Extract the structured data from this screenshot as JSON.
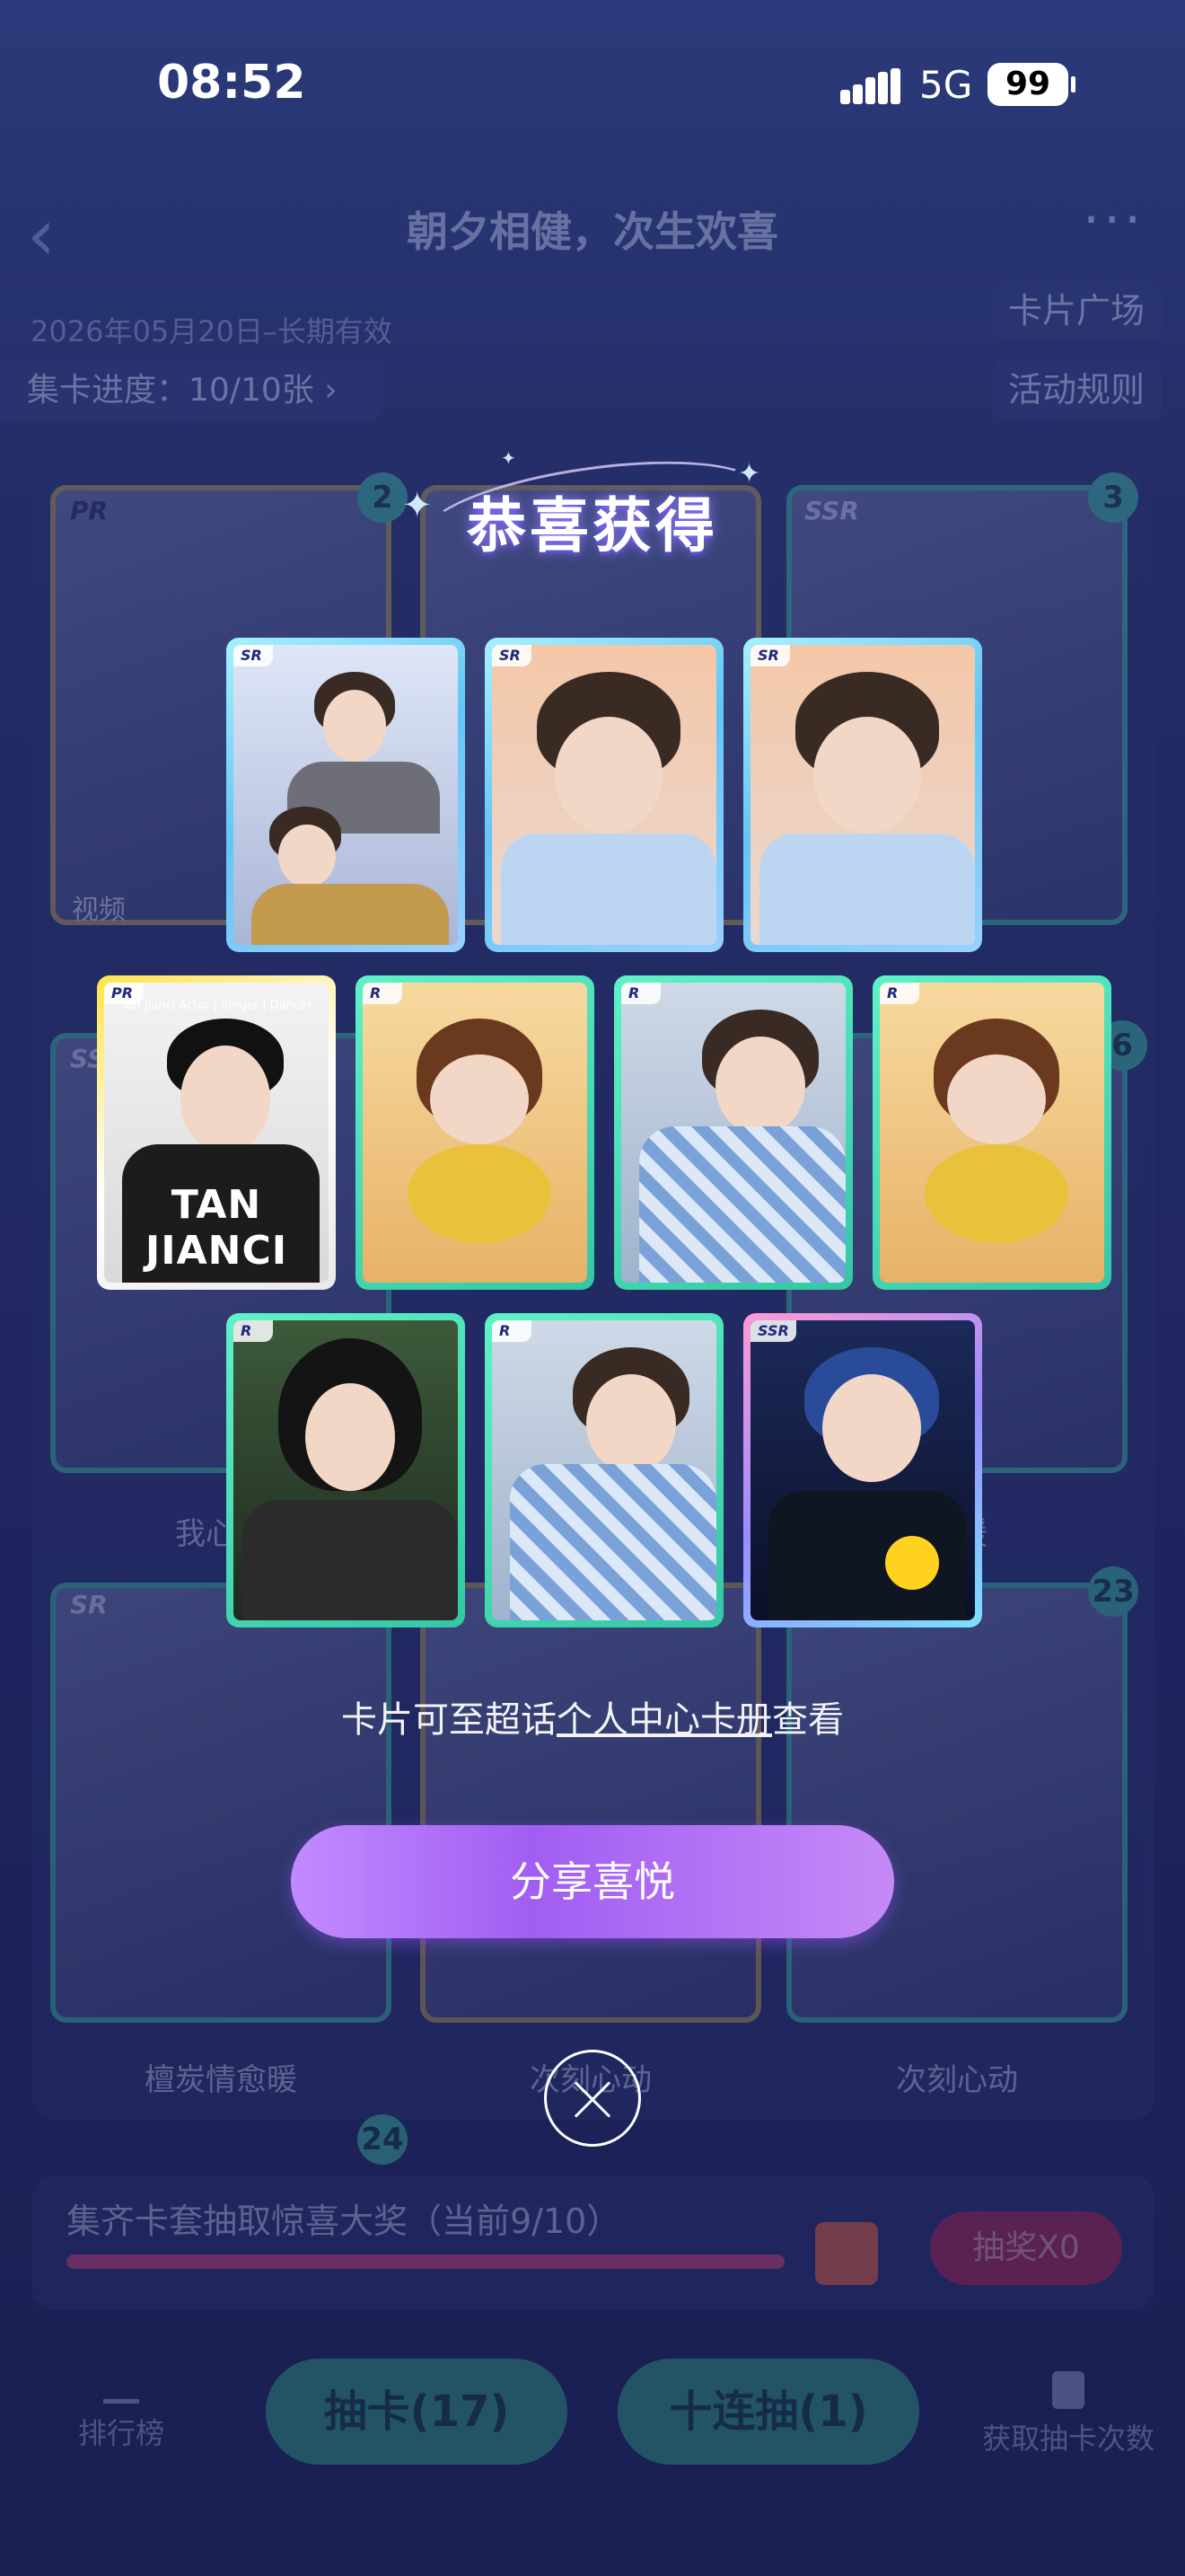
{
  "status": {
    "time": "08:52",
    "network": "5G",
    "battery": "99"
  },
  "page": {
    "title": "朝夕相健，次生欢喜",
    "validity": "2026年05月20日–长期有效",
    "progress": "集卡进度：10/10张 ›",
    "card_square": "卡片广场",
    "rules": "活动规则",
    "video_tag": "视频",
    "bg_labels": [
      "我心安",
      "愈暖",
      "檀炭情愈暖",
      "次刻心动",
      "次刻心动"
    ],
    "bg_counts": [
      "2",
      "3",
      "6",
      "23",
      "24"
    ],
    "bg_rarity": [
      "PR",
      "SSR",
      "SS",
      "SR"
    ],
    "collect_text": "集齐卡套抽取惊喜大奖（当前9/10）",
    "lottery_btn": "抽奖X0",
    "tabs": {
      "rank": "排行榜",
      "get_draws": "获取抽卡次数"
    },
    "draw_btn": "抽卡(17)",
    "ten_draw_btn": "十连抽(1)"
  },
  "modal": {
    "title": "恭喜获得",
    "cards": [
      {
        "rarity": "SR"
      },
      {
        "rarity": "SR"
      },
      {
        "rarity": "SR"
      },
      {
        "rarity": "PR",
        "sub": "Tan Jianci  Actor | Singer | Dancer",
        "tag": "TAN JIANCI"
      },
      {
        "rarity": "R"
      },
      {
        "rarity": "R"
      },
      {
        "rarity": "R"
      },
      {
        "rarity": "R"
      },
      {
        "rarity": "R"
      },
      {
        "rarity": "SSR"
      }
    ],
    "hint_pre": "卡片可至超话",
    "hint_link": "个人中心卡册",
    "hint_post": "查看",
    "share_btn": "分享喜悦"
  },
  "colors": {
    "accent": "#a25df2",
    "teal": "#3fc7a6",
    "background": "#1b2150"
  }
}
